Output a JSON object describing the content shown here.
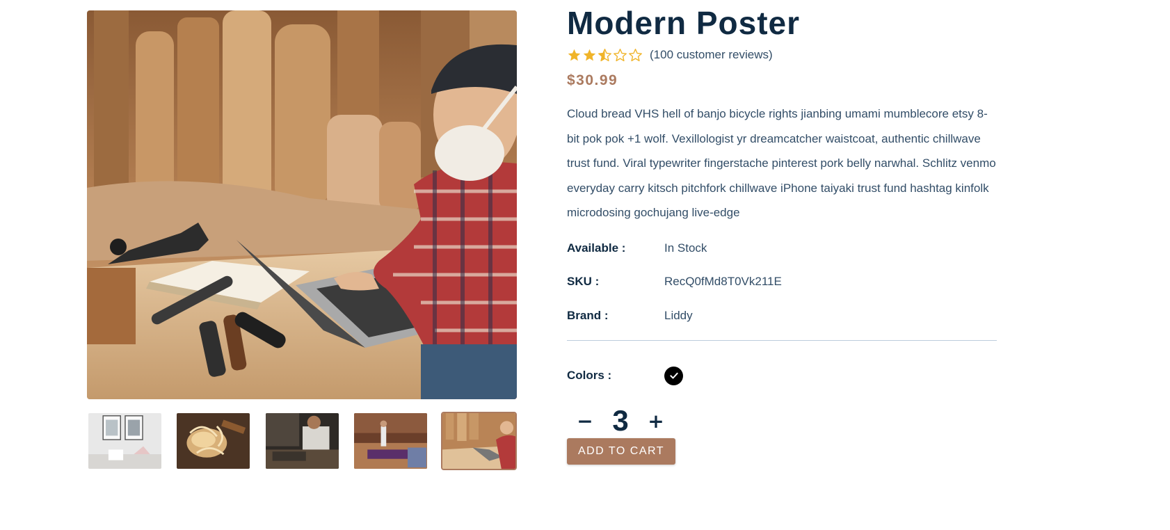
{
  "product": {
    "title": "Modern Poster",
    "rating": 2.5,
    "rating_max": 5,
    "reviews_text": "(100 customer reviews)",
    "price": "$30.99",
    "description": "Cloud bread VHS hell of banjo bicycle rights jianbing umami mumblecore etsy 8-bit pok pok +1 wolf. Vexillologist yr dreamcatcher waistcoat, authentic chillwave trust fund. Viral typewriter fingerstache pinterest pork belly narwhal. Schlitz venmo everyday carry kitsch pitchfork chillwave iPhone taiyaki trust fund hashtag kinfolk microdosing gochujang live-edge"
  },
  "meta": {
    "available_label": "Available :",
    "available_value": "In Stock",
    "sku_label": "SKU :",
    "sku_value": "RecQ0fMd8T0Vk211E",
    "brand_label": "Brand :",
    "brand_value": "Liddy"
  },
  "colors": {
    "label": "Colors :",
    "options": [
      "#000000"
    ],
    "selected": "#000000"
  },
  "quantity": {
    "minus": "−",
    "value": "3",
    "plus": "+"
  },
  "cart": {
    "add_label": "ADD TO CART"
  },
  "gallery": {
    "main_image": "man-in-mask-working-on-laptop-in-woodshop-photo",
    "thumbnails": [
      "posters-on-white-wall-photo",
      "wood-shavings-photo",
      "man-working-at-bench-photo",
      "workshop-interior-photo",
      "man-in-mask-working-on-laptop-in-woodshop-photo"
    ],
    "active_index": 4
  },
  "theme": {
    "accent": "#ab7a5f",
    "heading": "#102a42",
    "text": "#324d67",
    "star": "#f0b429"
  }
}
